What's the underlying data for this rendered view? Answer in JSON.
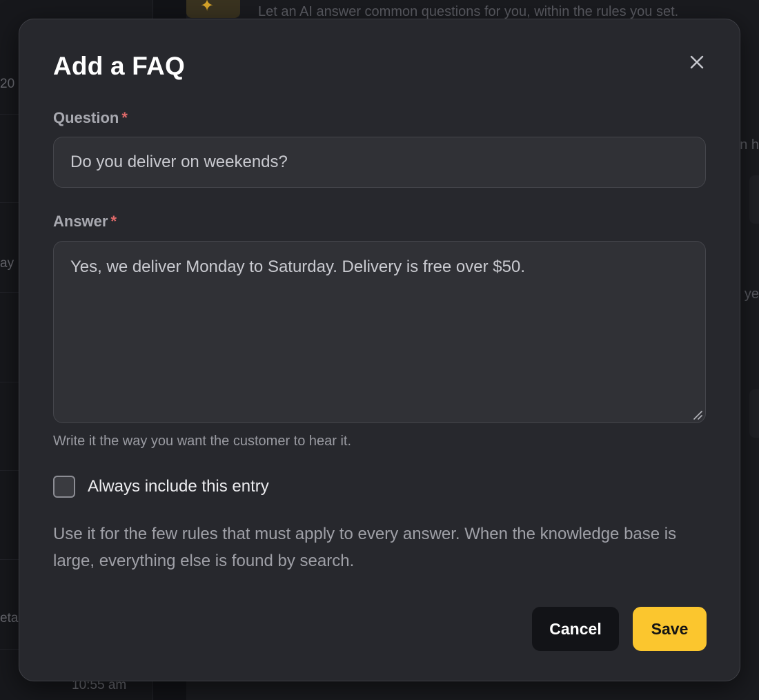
{
  "background": {
    "intro_text": "Let an AI answer common questions for you, within the rules you set.",
    "sidebar_fragments": [
      "20",
      "ay",
      "eta"
    ],
    "right_fragments": [
      "n h",
      "ye"
    ],
    "timestamp": "10:55 am"
  },
  "modal": {
    "title": "Add a FAQ",
    "close_icon": "close-icon",
    "question": {
      "label": "Question",
      "required_mark": "*",
      "value": "Do you deliver on weekends?"
    },
    "answer": {
      "label": "Answer",
      "required_mark": "*",
      "value": "Yes, we deliver Monday to Saturday. Delivery is free over $50.",
      "helper": "Write it the way you want the customer to hear it."
    },
    "always_include": {
      "label": "Always include this entry",
      "checked": false
    },
    "note": "Use it for the few rules that must apply to every answer. When the knowledge base is large, everything else is found by search.",
    "buttons": {
      "cancel": "Cancel",
      "save": "Save"
    },
    "colors": {
      "accent": "#fbc62e",
      "required": "#e06a6a",
      "surface": "#27282d"
    }
  }
}
